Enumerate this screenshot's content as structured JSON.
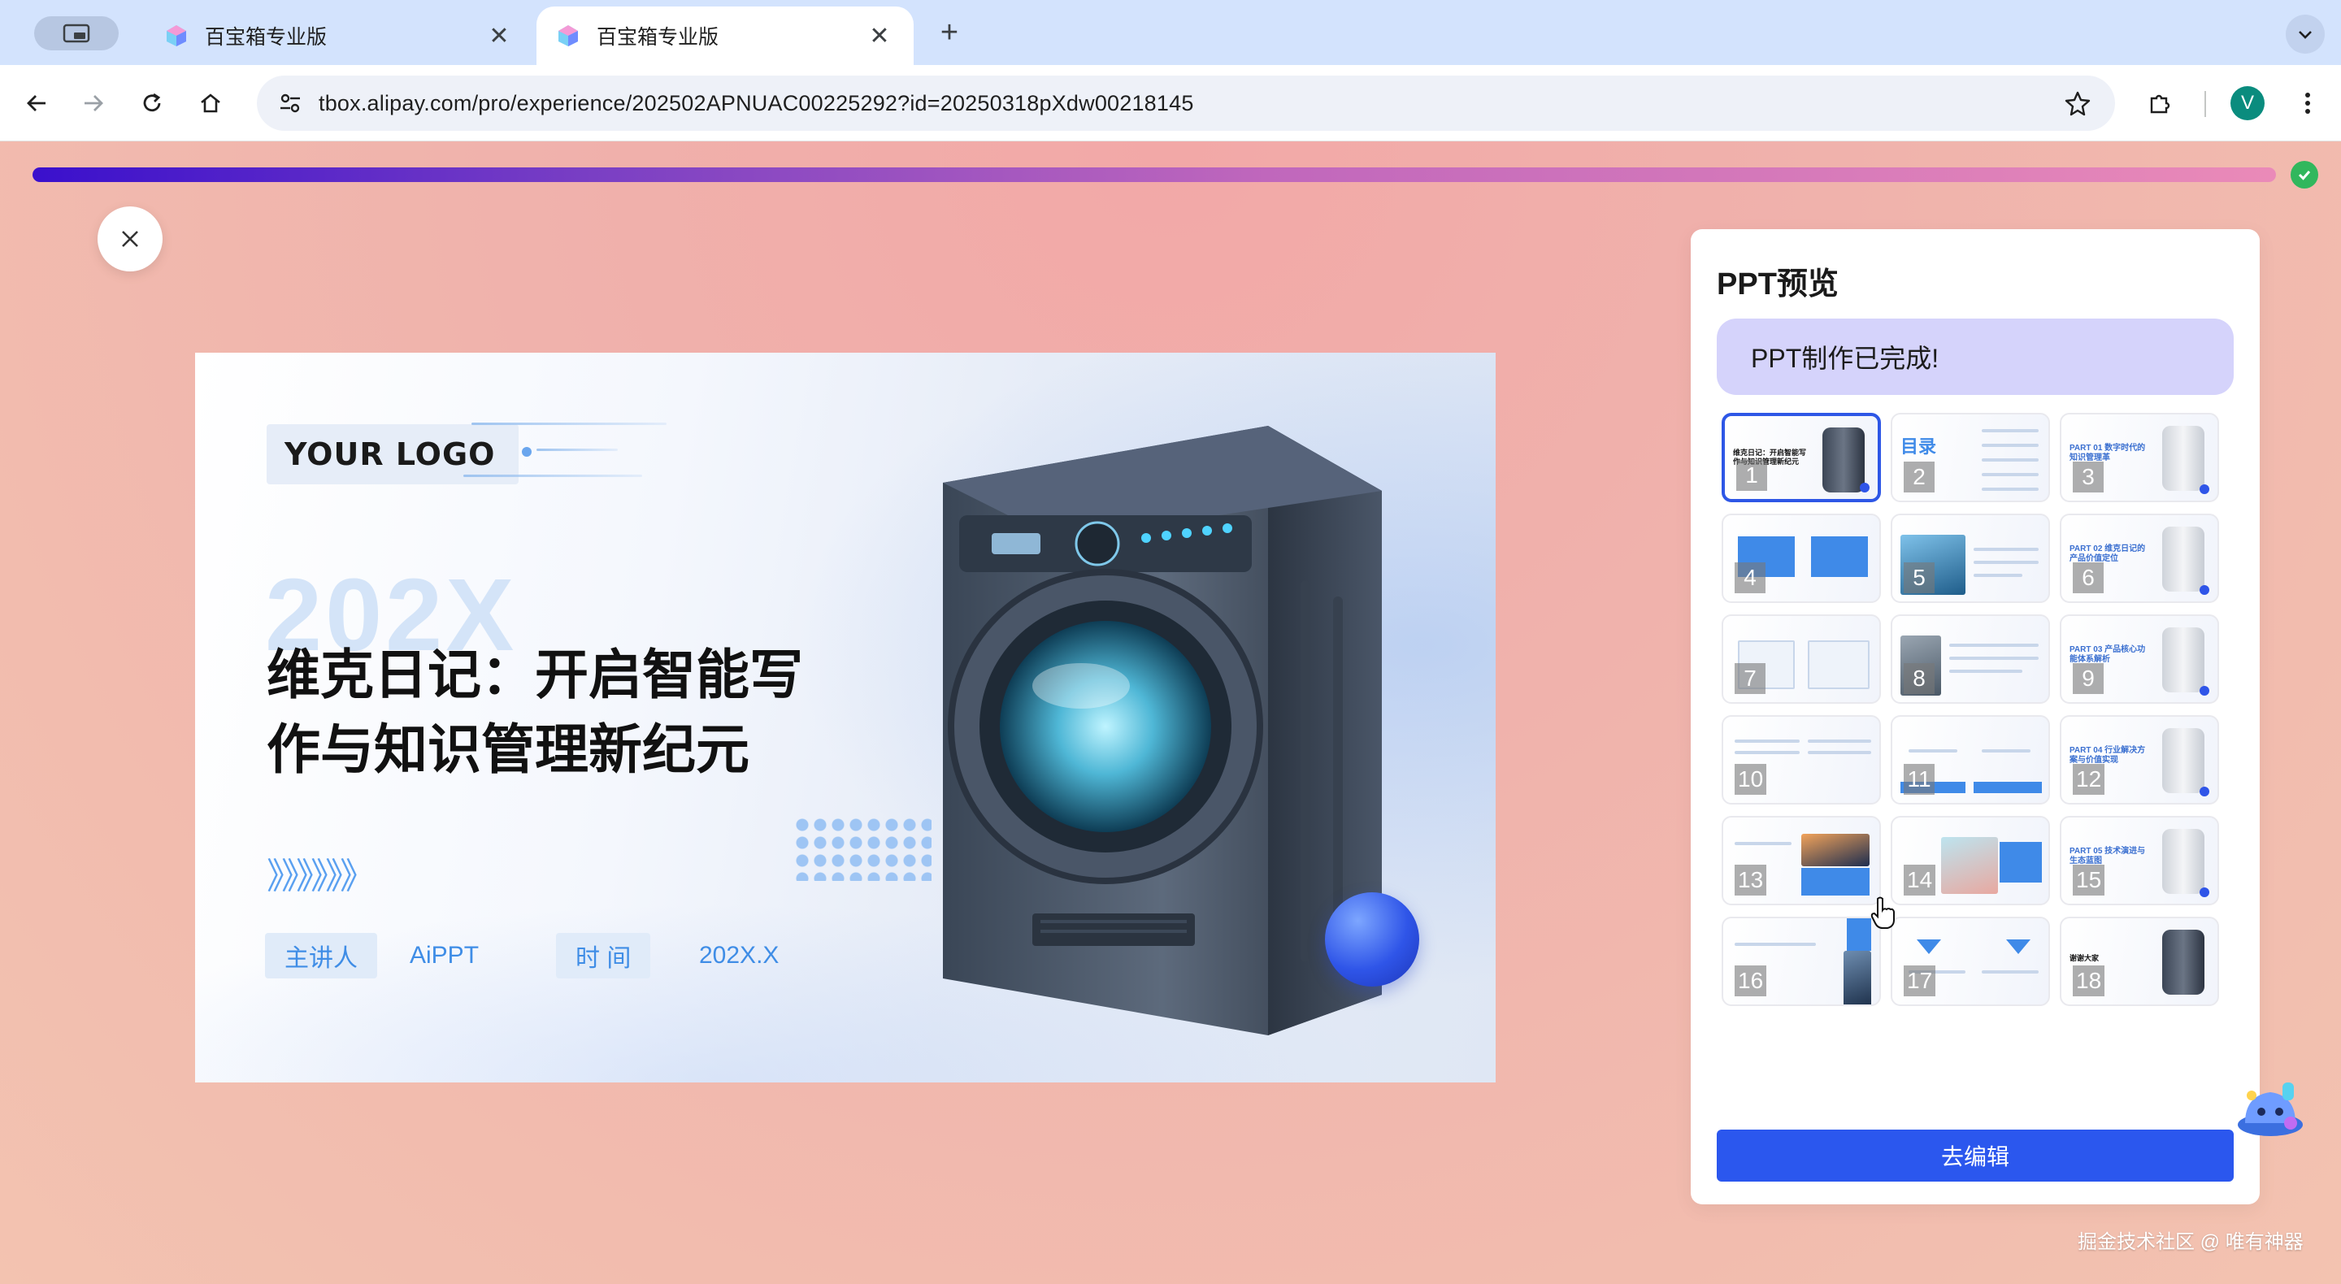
{
  "browser": {
    "tabs": [
      {
        "title": "百宝箱专业版",
        "active": false
      },
      {
        "title": "百宝箱专业版",
        "active": true
      }
    ],
    "url": "tbox.alipay.com/pro/experience/202502APNUAC00225292?id=20250318pXdw00218145",
    "profile_initial": "V"
  },
  "progress": {
    "value": 1.0,
    "complete": true
  },
  "slide": {
    "logo": "YOUR LOGO",
    "year_ghost": "202X",
    "title_line1": "维克日记：开启智能写",
    "title_line2": "作与知识管理新纪元",
    "chevrons": "》》》》》》",
    "presenter_label": "主讲人",
    "presenter_value": "AiPPT",
    "time_label": "时 间",
    "time_value": "202X.X"
  },
  "panel": {
    "title": "PPT预览",
    "status": "PPT制作已完成!",
    "edit_button": "去编辑",
    "thumbnails": [
      {
        "num": "1",
        "kind": "cover",
        "text": "维克日记：开启智能写作与知识管理新纪元"
      },
      {
        "num": "2",
        "kind": "toc",
        "text": "目录"
      },
      {
        "num": "3",
        "kind": "part",
        "text": "PART 01 数字时代的知识管理革"
      },
      {
        "num": "4",
        "kind": "content",
        "text": ""
      },
      {
        "num": "5",
        "kind": "content-photo",
        "text": ""
      },
      {
        "num": "6",
        "kind": "part",
        "text": "PART 02 维克日记的产品价值定位"
      },
      {
        "num": "7",
        "kind": "content",
        "text": ""
      },
      {
        "num": "8",
        "kind": "content-photo",
        "text": ""
      },
      {
        "num": "9",
        "kind": "part",
        "text": "PART 03 产品核心功能体系解析"
      },
      {
        "num": "10",
        "kind": "content",
        "text": ""
      },
      {
        "num": "11",
        "kind": "content-bars",
        "text": ""
      },
      {
        "num": "12",
        "kind": "part",
        "text": "PART 04 行业解决方案与价值实现"
      },
      {
        "num": "13",
        "kind": "content-photo-city",
        "text": ""
      },
      {
        "num": "14",
        "kind": "content-photo-blue",
        "text": ""
      },
      {
        "num": "15",
        "kind": "part",
        "text": "PART 05 技术演进与生态蓝图"
      },
      {
        "num": "16",
        "kind": "content-photo-side",
        "text": ""
      },
      {
        "num": "17",
        "kind": "content-triangles",
        "text": ""
      },
      {
        "num": "18",
        "kind": "end",
        "text": "谢谢大家"
      }
    ]
  },
  "watermark": "掘金技术社区 @ 唯有神器",
  "colors": {
    "accent": "#2b57ee",
    "status_bg": "#d5d3fb",
    "progress_start": "#3a10cc",
    "progress_end": "#ea8ab8",
    "success": "#31b75d"
  }
}
